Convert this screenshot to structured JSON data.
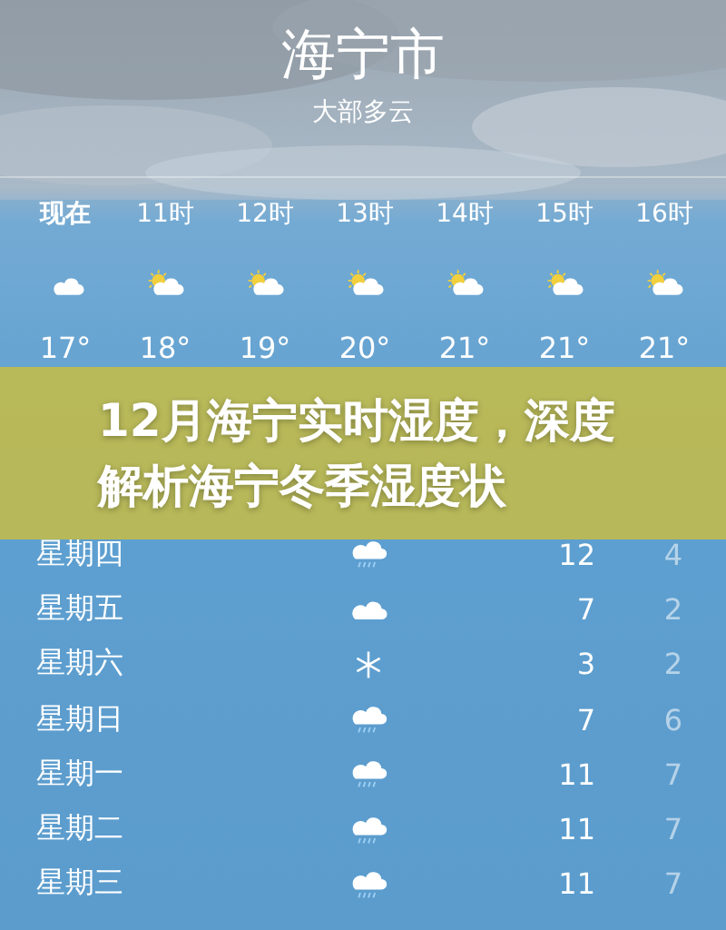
{
  "location": {
    "city": "海宁市",
    "condition": "大部多云"
  },
  "hourly": [
    {
      "time": "现在",
      "kind": "cloud",
      "temp": "17°",
      "current": true
    },
    {
      "time": "11时",
      "kind": "sun_cloud",
      "temp": "18°",
      "current": false
    },
    {
      "time": "12时",
      "kind": "sun_cloud",
      "temp": "19°",
      "current": false
    },
    {
      "time": "13时",
      "kind": "sun_cloud",
      "temp": "20°",
      "current": false
    },
    {
      "time": "14时",
      "kind": "sun_cloud",
      "temp": "21°",
      "current": false
    },
    {
      "time": "15时",
      "kind": "sun_cloud",
      "temp": "21°",
      "current": false
    },
    {
      "time": "16时",
      "kind": "sun_cloud",
      "temp": "21°",
      "current": false
    }
  ],
  "banner": {
    "title": "12月海宁实时湿度，深度解析海宁冬季湿度状"
  },
  "daily": [
    {
      "day": "星期四",
      "kind": "rain",
      "high": "12",
      "low": "4"
    },
    {
      "day": "星期五",
      "kind": "cloud",
      "high": "7",
      "low": "2"
    },
    {
      "day": "星期六",
      "kind": "snow",
      "high": "3",
      "low": "2"
    },
    {
      "day": "星期日",
      "kind": "rain",
      "high": "7",
      "low": "6"
    },
    {
      "day": "星期一",
      "kind": "rain",
      "high": "11",
      "low": "7"
    },
    {
      "day": "星期二",
      "kind": "rain",
      "high": "11",
      "low": "7"
    },
    {
      "day": "星期三",
      "kind": "rain",
      "high": "11",
      "low": "7"
    }
  ]
}
